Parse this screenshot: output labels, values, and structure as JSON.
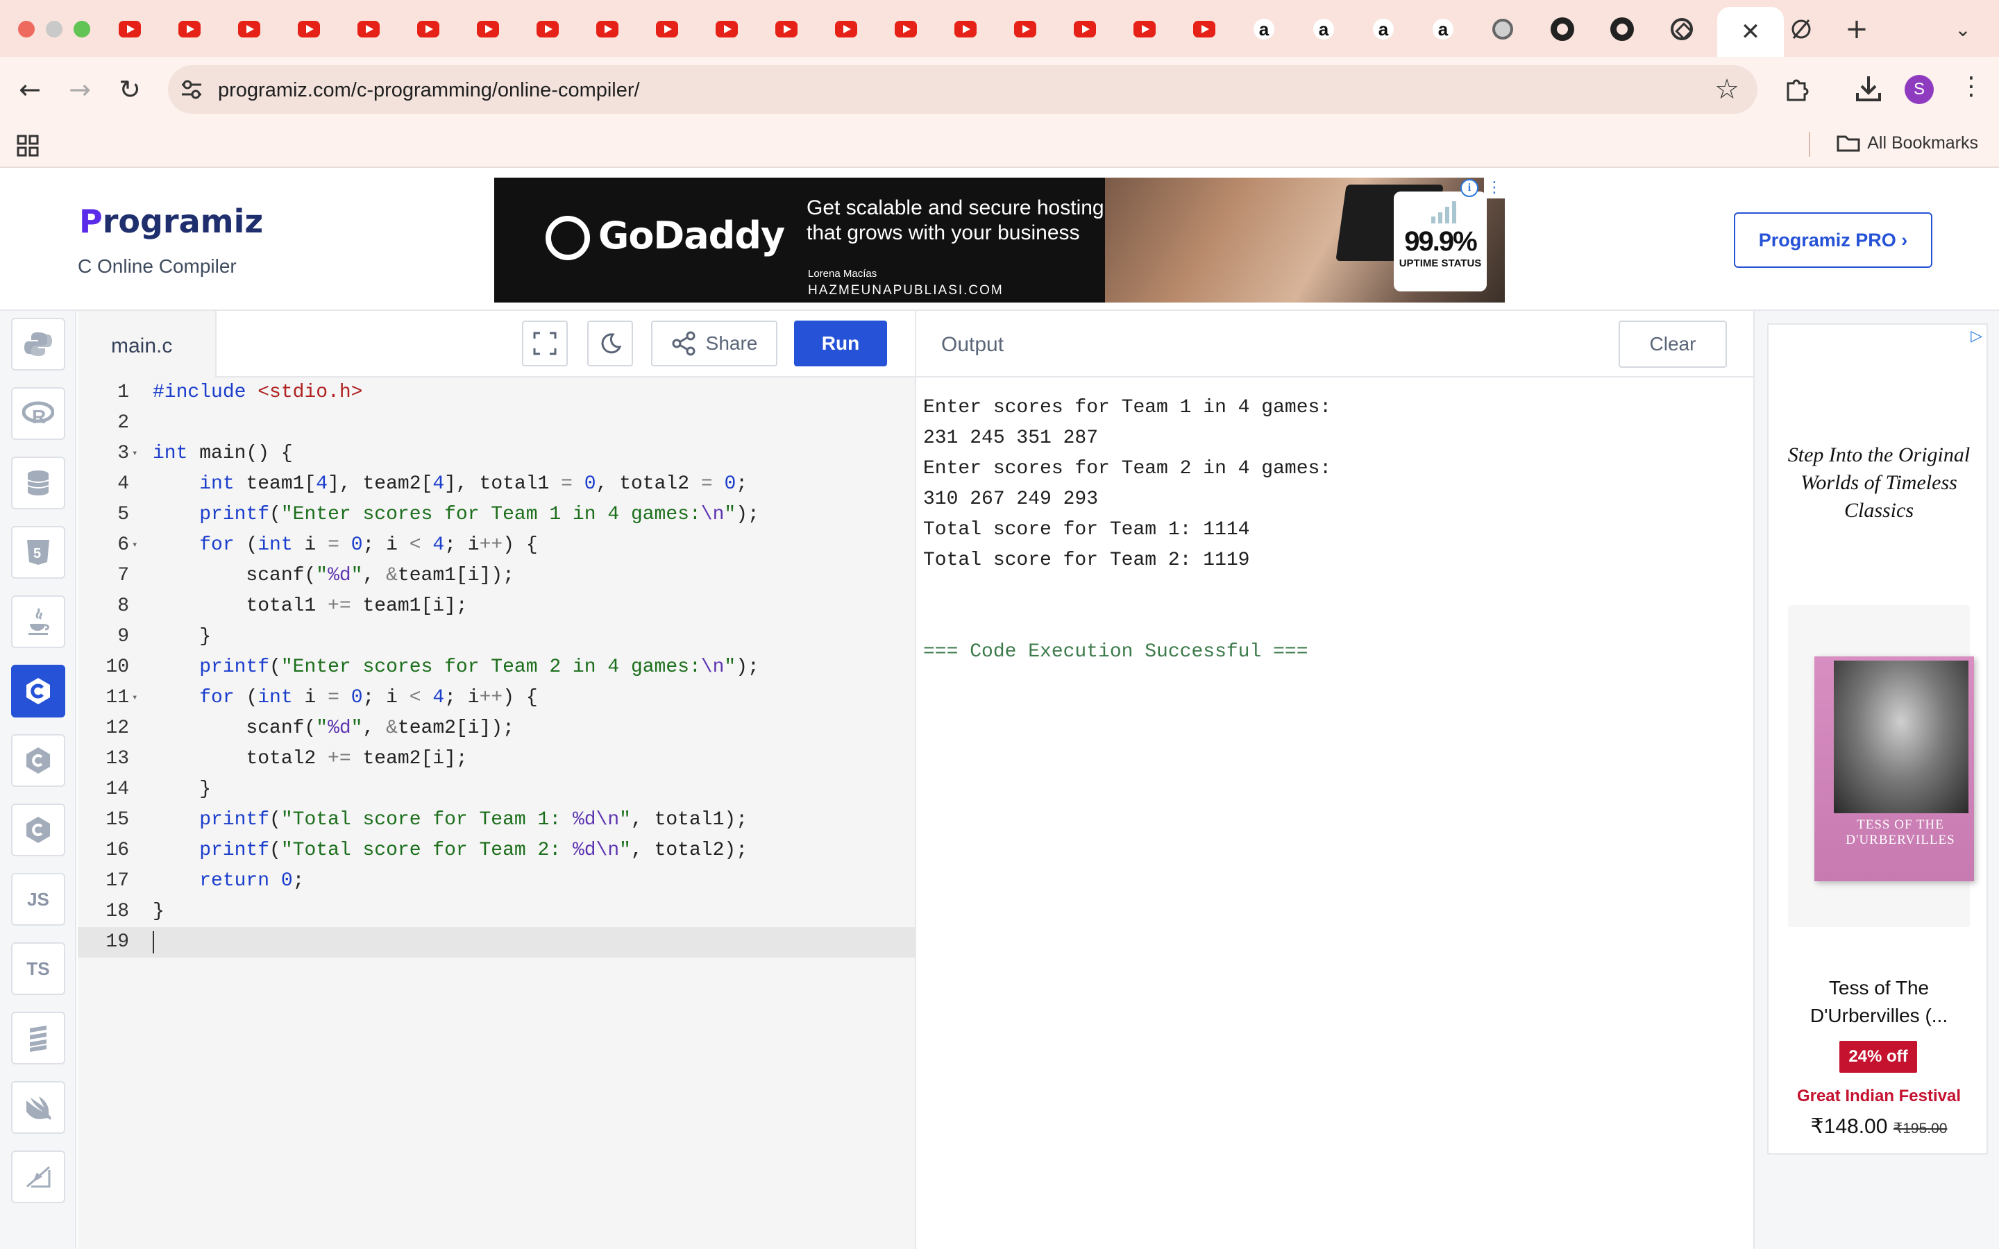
{
  "browser": {
    "address": "programiz.com/c-programming/online-compiler/",
    "all_bookmarks": "All Bookmarks",
    "profile_initial": "S",
    "amazon_glyph": "a"
  },
  "header": {
    "logo_first": "P",
    "logo_rest": "rogramiz",
    "subtitle": "C Online Compiler",
    "pro_button": "Programiz PRO ›"
  },
  "top_ad": {
    "brand": "GoDaddy",
    "headline": "Get scalable and secure hosting that grows with your business",
    "author": "Lorena Macías",
    "domain": "HAZMEUNAPUBLIASI.COM",
    "uptime_value": "99.9%",
    "uptime_label": "UPTIME STATUS"
  },
  "rail": {
    "items": [
      {
        "name": "python",
        "label": ""
      },
      {
        "name": "r",
        "label": ""
      },
      {
        "name": "sql",
        "label": ""
      },
      {
        "name": "html",
        "label": ""
      },
      {
        "name": "java",
        "label": ""
      },
      {
        "name": "c",
        "label": "",
        "active": true
      },
      {
        "name": "cpp",
        "label": ""
      },
      {
        "name": "csharp",
        "label": ""
      },
      {
        "name": "javascript",
        "label": "JS"
      },
      {
        "name": "typescript",
        "label": "TS"
      },
      {
        "name": "go",
        "label": ""
      },
      {
        "name": "swift",
        "label": ""
      },
      {
        "name": "rust",
        "label": ""
      }
    ]
  },
  "editor": {
    "filename": "main.c",
    "share_label": "Share",
    "run_label": "Run",
    "current_line": 19
  },
  "output": {
    "title": "Output",
    "clear_label": "Clear",
    "lines": [
      "Enter scores for Team 1 in 4 games:",
      "231 245 351 287",
      "Enter scores for Team 2 in 4 games:",
      "310 267 249 293",
      "Total score for Team 1: 1114",
      "Total score for Team 2: 1119",
      "",
      "",
      "=== Code Execution Successful ==="
    ]
  },
  "side_ad": {
    "tagline": "Step Into the Original Worlds of Timeless Classics",
    "book_title": "TESS OF THE D'URBERVILLES",
    "product_name": "Tess of The D'Urbervilles (...",
    "discount": "24% off",
    "festival": "Great Indian Festival",
    "price": "₹148.00",
    "old_price": "₹195.00"
  }
}
